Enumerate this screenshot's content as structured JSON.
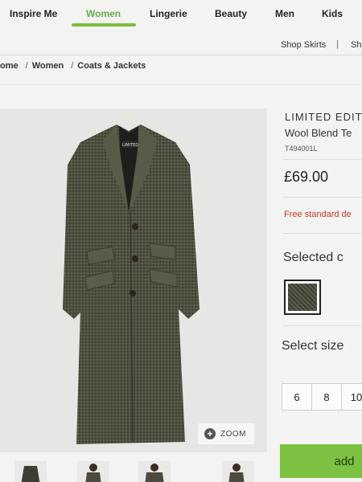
{
  "nav": {
    "items": [
      {
        "label": "Inspire Me"
      },
      {
        "label": "Women"
      },
      {
        "label": "Lingerie"
      },
      {
        "label": "Beauty"
      },
      {
        "label": "Men"
      },
      {
        "label": "Kids"
      }
    ],
    "active_color": "#6aa84f"
  },
  "subnav": {
    "items": [
      {
        "label": "Shop Skirts"
      },
      {
        "label": "Sh"
      }
    ],
    "separator": "|"
  },
  "breadcrumb": {
    "items": [
      "ome",
      "Women",
      "Coats & Jackets"
    ],
    "separator": "/"
  },
  "product": {
    "title_line1": "LIMITED EDIT",
    "title_line2": "Wool Blend Te",
    "code": "T494001L",
    "price": "£69.00",
    "delivery": "Free standard de",
    "price_color": "#222222",
    "delivery_color": "#c0392b"
  },
  "colour": {
    "label": "Selected c"
  },
  "size": {
    "label": "Select size",
    "options": [
      "6",
      "8",
      "10"
    ]
  },
  "zoom": {
    "label": "ZOOM",
    "icon": "plus-icon"
  },
  "add_button": {
    "label": "add",
    "color": "#7cc142"
  }
}
